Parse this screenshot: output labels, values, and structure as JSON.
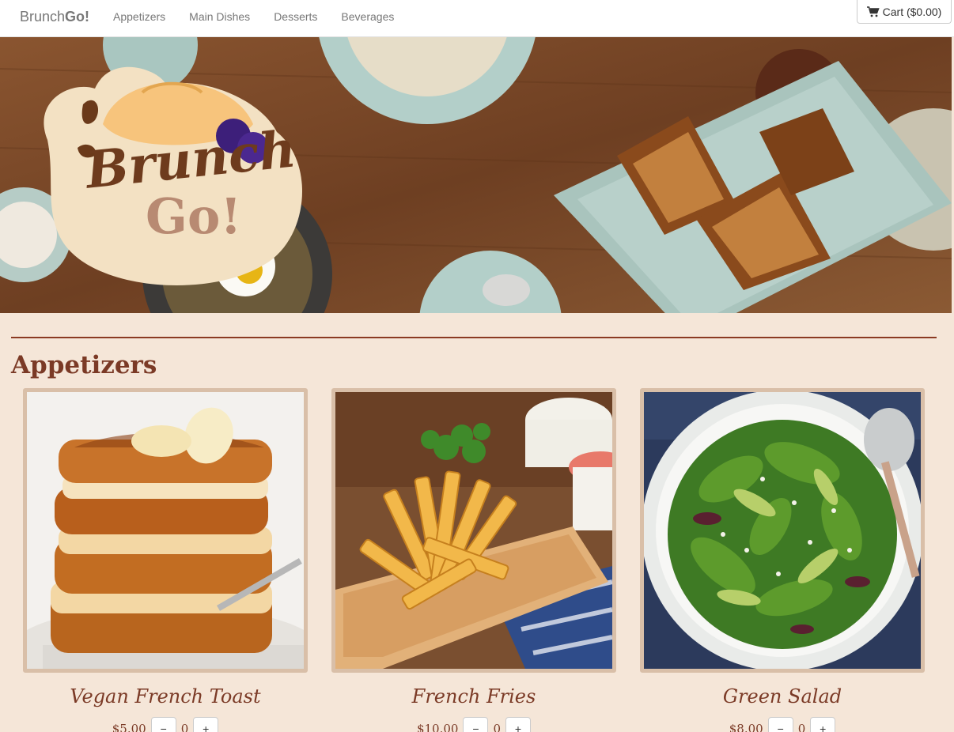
{
  "nav": {
    "brand_light": "Brunch",
    "brand_bold": "Go!",
    "links": [
      "Appetizers",
      "Main Dishes",
      "Desserts",
      "Beverages"
    ],
    "cart_label": "Cart ($0.00)",
    "cart_icon": "shopping-cart-icon"
  },
  "hero": {
    "logo_line1": "Brunch",
    "logo_line2": "Go!"
  },
  "section": {
    "title": "Appetizers"
  },
  "items": [
    {
      "name": "Vegan French Toast",
      "price": "$5.00",
      "minus": "−",
      "qty": "0",
      "plus": "+"
    },
    {
      "name": "French Fries",
      "price": "$10.00",
      "minus": "−",
      "qty": "0",
      "plus": "+"
    },
    {
      "name": "Green Salad",
      "price": "$8.00",
      "minus": "−",
      "qty": "0",
      "plus": "+"
    }
  ],
  "colors": {
    "page_bg": "#f5e6d8",
    "accent": "#7b3a26",
    "rule": "#8b3a22",
    "card_border": "#d9bfa8"
  }
}
